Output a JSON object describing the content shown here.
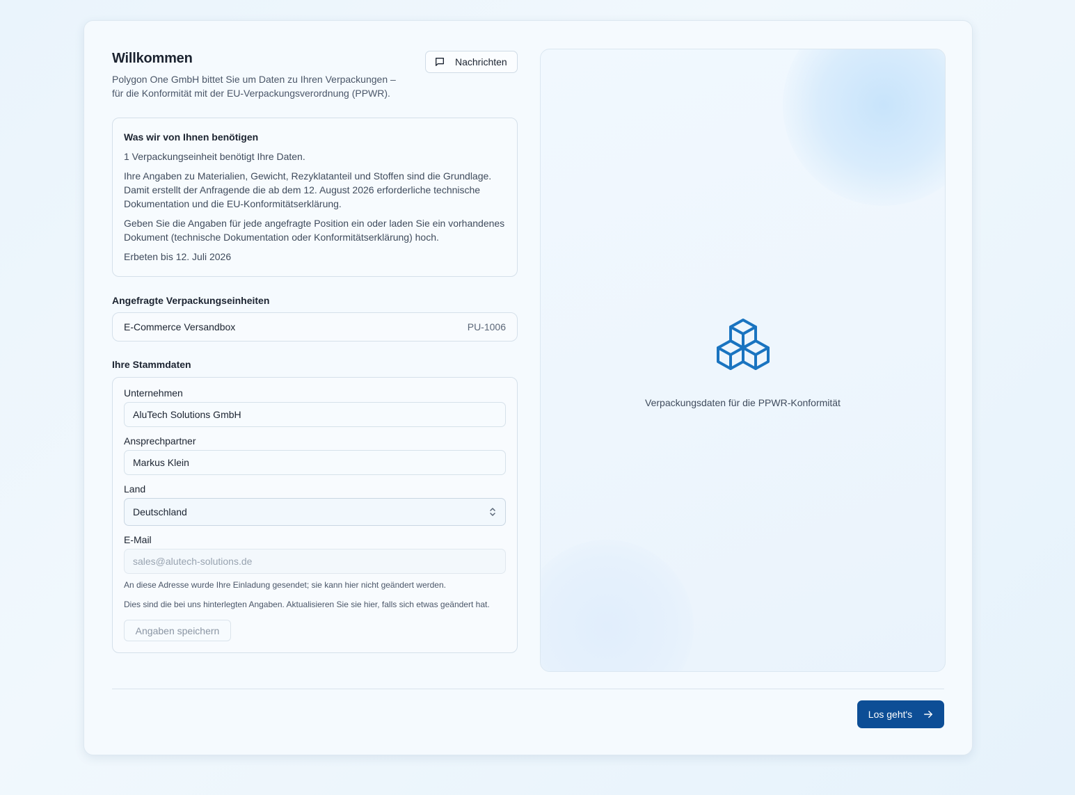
{
  "header": {
    "title": "Willkommen",
    "subtitle_line1": "Polygon One GmbH bittet Sie um Daten zu Ihren Verpackungen –",
    "subtitle_line2": "für die Konformität mit der EU-Verpackungsverordnung (PPWR).",
    "messages_label": "Nachrichten",
    "messages_icon": "message-square-icon"
  },
  "info": {
    "heading": "Was wir von Ihnen benötigen",
    "units_needed": "1 Verpackungseinheit benötigt Ihre Daten.",
    "basis": "Ihre Angaben zu Materialien, Gewicht, Rezyklatanteil und Stoffen sind die Grundlage. Damit erstellt der Anfragende die ab dem 12. August 2026 erforderliche technische Dokumentation und die EU-Konformitätserklärung.",
    "instruction": "Geben Sie die Angaben für jede angefragte Position ein oder laden Sie ein vorhandenes Dokument (technische Dokumentation oder Konformitätserklärung) hoch.",
    "deadline": "Erbeten bis 12. Juli 2026"
  },
  "requested_units": {
    "label": "Angefragte Verpackungseinheiten",
    "items": [
      {
        "name": "E-Commerce Versandbox",
        "id": "PU-1006"
      }
    ]
  },
  "master_data": {
    "label": "Ihre Stammdaten",
    "company_label": "Unternehmen",
    "company_value": "AluTech Solutions GmbH",
    "contact_label": "Ansprechpartner",
    "contact_value": "Markus Klein",
    "country_label": "Land",
    "country_value": "Deutschland",
    "email_label": "E-Mail",
    "email_value": "sales@alutech-solutions.de",
    "email_hint": "An diese Adresse wurde Ihre Einladung gesendet; sie kann hier nicht geändert werden.",
    "update_hint": "Dies sind die bei uns hinterlegten Angaben. Aktualisieren Sie sie hier, falls sich etwas geändert hat.",
    "save_label": "Angaben speichern"
  },
  "hero": {
    "icon": "boxes-icon",
    "caption": "Verpackungsdaten für die PPWR-Konformität"
  },
  "footer": {
    "go_label": "Los geht's",
    "go_icon": "arrow-right-icon"
  },
  "colors": {
    "primary": "#0d4e96",
    "icon_blue": "#1a74c0",
    "background": "#eaf4fc"
  }
}
